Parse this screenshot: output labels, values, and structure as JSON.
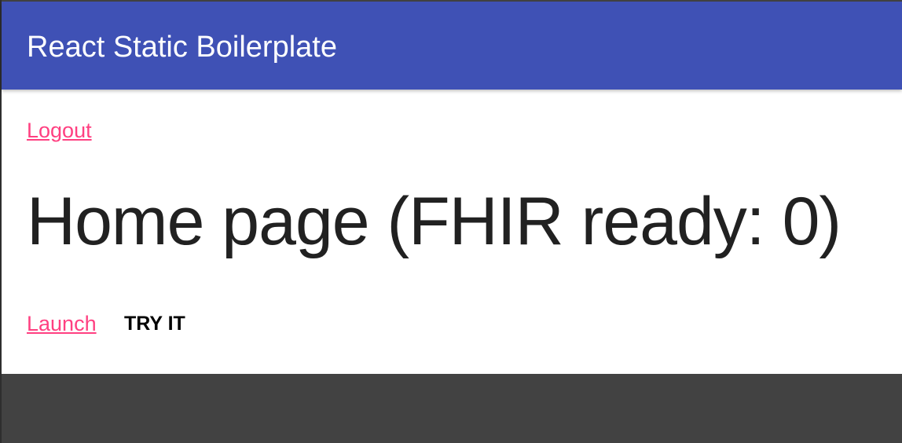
{
  "appbar": {
    "title": "React Static Boilerplate"
  },
  "nav": {
    "logout_label": "Logout"
  },
  "main": {
    "heading": "Home page (FHIR ready: 0)",
    "launch_label": "Launch",
    "try_button_label": "TRY IT"
  },
  "colors": {
    "appbar_bg": "#3f51b5",
    "link": "#ff4081",
    "heading_text": "#212121",
    "page_bg": "#ffffff",
    "outer_bg": "#424242"
  }
}
